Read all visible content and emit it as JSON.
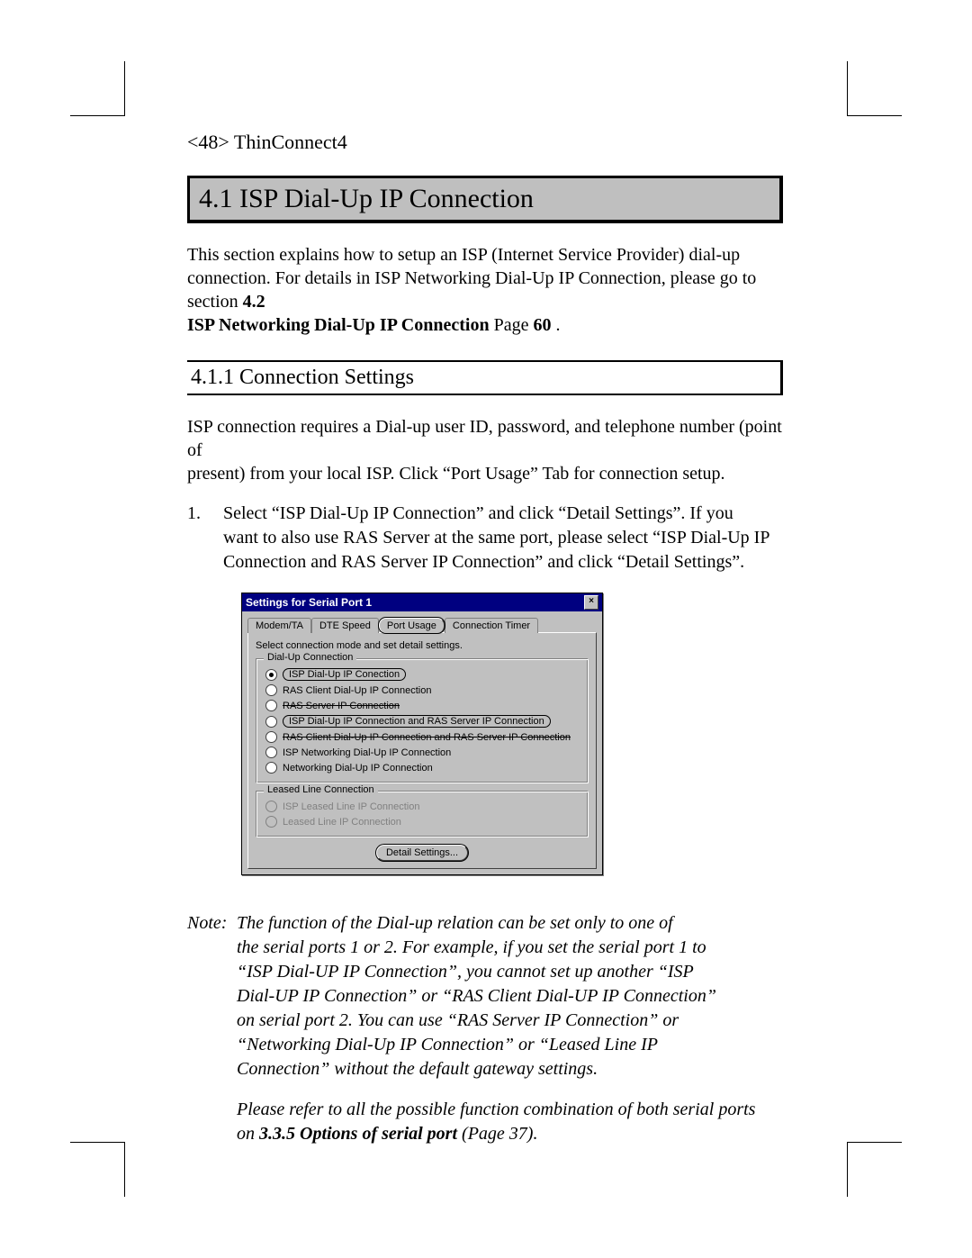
{
  "page_header": "<48> ThinConnect4",
  "section_title": "4.1 ISP Dial-Up IP Connection",
  "intro": {
    "line1": "This section explains how to setup an ISP (Internet Service Provider) dial-up",
    "line2a": "connection.  For details in ISP Networking Dial-Up IP Connection, please go to section ",
    "line2b_bold": "4.2",
    "line3a_bold": "ISP Networking Dial-Up IP Connection",
    "line3b": " Page ",
    "line3c_bold": "60",
    "line3d": " ."
  },
  "subsection_title": "4.1.1 Connection Settings",
  "para2": {
    "l1": "ISP connection requires a Dial-up user ID, password, and telephone number (point of",
    "l2": "present) from your local ISP.  Click “Port Usage” Tab for connection setup."
  },
  "step1": {
    "num": "1.",
    "l1": "Select “ISP Dial-Up IP Connection” and click “Detail Settings”.  If you",
    "l2": "want to also use RAS Server at the same port, please select “ISP Dial-Up IP",
    "l3": "Connection and RAS Server IP Connection” and click “Detail Settings”."
  },
  "dialog": {
    "title": "Settings for Serial Port 1",
    "close": "×",
    "tabs": {
      "modem": "Modem/TA",
      "dte": "DTE Speed",
      "port": "Port Usage",
      "timer": "Connection Timer"
    },
    "instruct": "Select connection mode and set detail settings.",
    "group1_legend": "Dial-Up Connection",
    "opts": {
      "o1": "ISP Dial-Up IP Conection",
      "o2": "RAS Client Dial-Up IP Connection",
      "o3": "RAS Server IP Connection",
      "o4": "ISP Dial-Up IP Connection and RAS Server IP Connection",
      "o5": "RAS Client Dial-Up IP Connection and RAS Server IP Connection",
      "o6": "ISP Networking Dial-Up IP Connection",
      "o7": "Networking Dial-Up IP Connection"
    },
    "group2_legend": "Leased Line Connection",
    "opts2": {
      "o8": "ISP Leased Line IP Connection",
      "o9": "Leased Line IP Connection"
    },
    "detail_btn": "Detail Settings..."
  },
  "note": {
    "label": "Note:",
    "l1": "The function of the Dial-up relation can be set only to one of",
    "l2": "the serial ports 1 or 2.  For example, if you set the serial port 1 to",
    "l3": "“ISP Dial-UP IP Connection”, you cannot set up another “ISP",
    "l4": "Dial-UP IP Connection” or “RAS Client Dial-UP IP Connection”",
    "l5": "on serial port 2. You can use “RAS Server IP Connection” or",
    "l6": "“Networking Dial-Up IP Connection” or “Leased Line IP",
    "l7": "Connection” without the default gateway settings.",
    "p2l1": "Please refer to all the possible function combination of both serial ports",
    "p2l2a": "on ",
    "p2l2b_bold": "3.3.5 Options of serial port",
    "p2l2c": " (Page 37)."
  }
}
